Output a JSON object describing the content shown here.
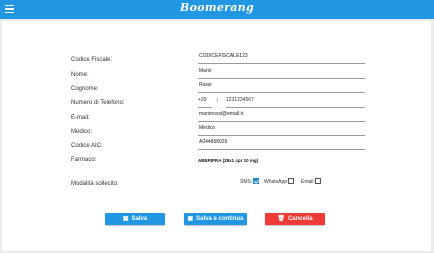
{
  "header": {
    "logo": "Boomerang"
  },
  "form": {
    "codice_fiscale": {
      "label": "Codice Fiscale:",
      "value": "CODICEFISCALE123"
    },
    "nome": {
      "label": "Nome:",
      "value": "Mario"
    },
    "cognome": {
      "label": "Cognome:",
      "value": "Rossi"
    },
    "telefono": {
      "label": "Numero di Telefono:",
      "prefix": "+39",
      "value": "1231234567"
    },
    "email": {
      "label": "E-mail:",
      "value": "mariorossi@email.it"
    },
    "medico": {
      "label": "Medico:",
      "value": "Medico"
    },
    "codice_aic": {
      "label": "Codice AIC:",
      "value": "A044868026"
    },
    "farmaco": {
      "label": "Farmaco:",
      "value": "ABERIPRA (28x1 cpr 10 mg)"
    },
    "sollecito": {
      "label": "Modalità sollecito:",
      "options": [
        {
          "label": "SMS:",
          "checked": true
        },
        {
          "label": "WhatsApp:",
          "checked": false
        },
        {
          "label": "Email:",
          "checked": false
        }
      ]
    }
  },
  "buttons": {
    "save": "Salva",
    "save_continue": "Salva e continua",
    "cancel": "Cancella"
  },
  "colors": {
    "primary": "#2196e3",
    "danger": "#ef3b36"
  },
  "icons": {
    "menu": "hamburger-icon",
    "save": "floppy-icon",
    "delete": "trash-icon",
    "dropdown": "arrow-down-icon"
  }
}
